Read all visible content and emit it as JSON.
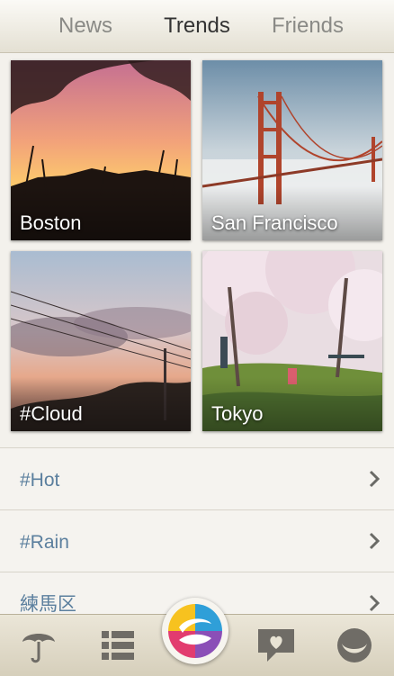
{
  "tabs": [
    {
      "label": "News",
      "active": false
    },
    {
      "label": "Trends",
      "active": true
    },
    {
      "label": "Friends",
      "active": false
    }
  ],
  "tiles": [
    {
      "caption": "Boston",
      "image": "sunset with grass silhouettes"
    },
    {
      "caption": "San Francisco",
      "image": "golden gate bridge in fog"
    },
    {
      "caption": "#Cloud",
      "image": "cloudy evening sky with power lines"
    },
    {
      "caption": "Tokyo",
      "image": "cherry blossom park"
    }
  ],
  "list": [
    {
      "label": "#Hot"
    },
    {
      "label": "#Rain"
    },
    {
      "label": "練馬区"
    }
  ],
  "bottom_bar": {
    "icons": [
      "umbrella-icon",
      "list-icon",
      "app-logo-icon",
      "chat-heart-icon",
      "face-icon"
    ]
  },
  "colors": {
    "list_text": "#5b7f9e",
    "active_tab": "#333333",
    "inactive_tab": "#8a8a86"
  }
}
